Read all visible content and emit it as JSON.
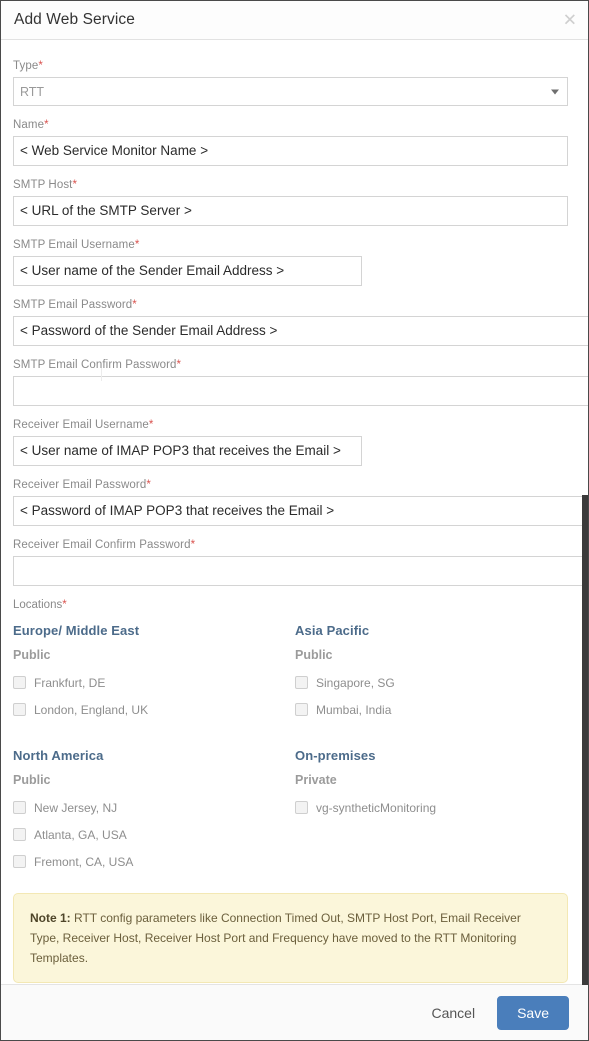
{
  "dialog": {
    "title": "Add Web Service",
    "close_icon": "close-icon"
  },
  "form": {
    "type": {
      "label": "Type",
      "required": "*",
      "value": "RTT",
      "caret_icon": "chevron-down-icon"
    },
    "fields": [
      {
        "label": "Name",
        "required": "*",
        "value": "< Web Service Monitor Name >"
      },
      {
        "label": "SMTP Host",
        "required": "*",
        "value": "< URL of the SMTP Server >"
      },
      {
        "label": "SMTP Email Username",
        "required": "*",
        "value": "< User name of the Sender Email Address >"
      },
      {
        "label": "SMTP Email Password",
        "required": "*",
        "value": "< Password of the Sender Email Address >"
      },
      {
        "label": "SMTP Email Confirm Password",
        "required": "*",
        "value": ""
      },
      {
        "label": "Receiver Email Username",
        "required": "*",
        "value": "< User name of IMAP POP3 that receives the Email >"
      },
      {
        "label": "Receiver Email Password",
        "required": "*",
        "value": "< Password of IMAP POP3 that receives the Email >"
      },
      {
        "label": "Receiver Email Confirm Password",
        "required": "*",
        "value": ""
      }
    ]
  },
  "locations": {
    "label": "Locations",
    "required": "*",
    "regions": [
      {
        "title": "Europe/ Middle East",
        "visibility": "Public",
        "items": [
          {
            "label": "Frankfurt, DE",
            "checked": false
          },
          {
            "label": "London, England, UK",
            "checked": false
          }
        ]
      },
      {
        "title": "Asia Pacific",
        "visibility": "Public",
        "items": [
          {
            "label": "Singapore, SG",
            "checked": false
          },
          {
            "label": "Mumbai, India",
            "checked": false
          }
        ]
      },
      {
        "title": "North America",
        "visibility": "Public",
        "items": [
          {
            "label": "New Jersey, NJ",
            "checked": false
          },
          {
            "label": "Atlanta, GA, USA",
            "checked": false
          },
          {
            "label": "Fremont, CA, USA",
            "checked": false
          }
        ]
      },
      {
        "title": "On-premises",
        "visibility": "Private",
        "items": [
          {
            "label": "vg-syntheticMonitoring",
            "checked": false
          }
        ]
      }
    ]
  },
  "note": {
    "prefix": "Note 1:",
    "text": " RTT config parameters like Connection Timed Out, SMTP Host Port, Email Receiver Type, Receiver Host, Receiver Host Port and Frequency have moved to the RTT Monitoring Templates."
  },
  "footer": {
    "cancel_label": "Cancel",
    "save_label": "Save"
  },
  "colors": {
    "primary": "#4a7ebb",
    "required": "#d9534f",
    "region_heading": "#4c6b8a",
    "note_bg": "#fbf6da",
    "note_border": "#f3e8b4"
  }
}
